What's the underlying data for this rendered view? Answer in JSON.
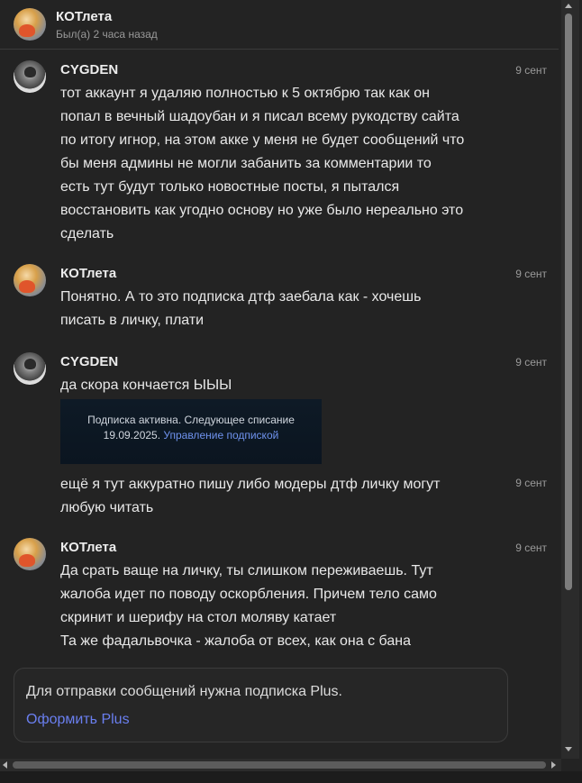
{
  "header": {
    "name": "КОТлета",
    "status": "Был(а) 2 часа назад"
  },
  "messages": [
    {
      "author": "CYGDEN",
      "time": "9 сент",
      "lines": [
        "тот аккаунт я удаляю полностью к 5 октябрю так как он",
        "попал в вечный шадоубан и я писал всему рукодству сайта",
        "по итогу игнор, на этом акке у меня не будет сообщений что",
        "бы меня админы не могли забанить за комментарии то",
        "есть тут будут только новостные посты, я пытался",
        "восстановить как угодно основу но уже было нереально это",
        "сделать"
      ]
    },
    {
      "author": "КОТлета",
      "time": "9 сент",
      "lines": [
        "Понятно. А то это подписка дтф заебала как - хочешь",
        "писать в личку, плати"
      ]
    },
    {
      "author": "CYGDEN",
      "time": "9 сент",
      "lines": [
        "да скора кончается ЫЫЫ"
      ],
      "card": {
        "line1": "Подписка активна. Следующее списание",
        "line2_text": "19.09.2025.",
        "line2_link": "Управление подпиской"
      }
    },
    {
      "time": "9 сент",
      "lines": [
        "ещё я тут аккуратно пишу либо модеры дтф личку могут",
        "любую читать"
      ]
    },
    {
      "author": "КОТлета",
      "time": "9 сент",
      "lines": [
        "Да срать ваще на личку, ты слишком переживаешь. Тут",
        "жалоба идет по поводу оскорбления. Причем тело само",
        "скринит и шерифу на стол моляву катает",
        "Та же фадальвочка - жалоба от всех, как она с бана"
      ]
    }
  ],
  "compose": {
    "notice": "Для отправки сообщений нужна подписка Plus.",
    "link": "Оформить Plus"
  }
}
